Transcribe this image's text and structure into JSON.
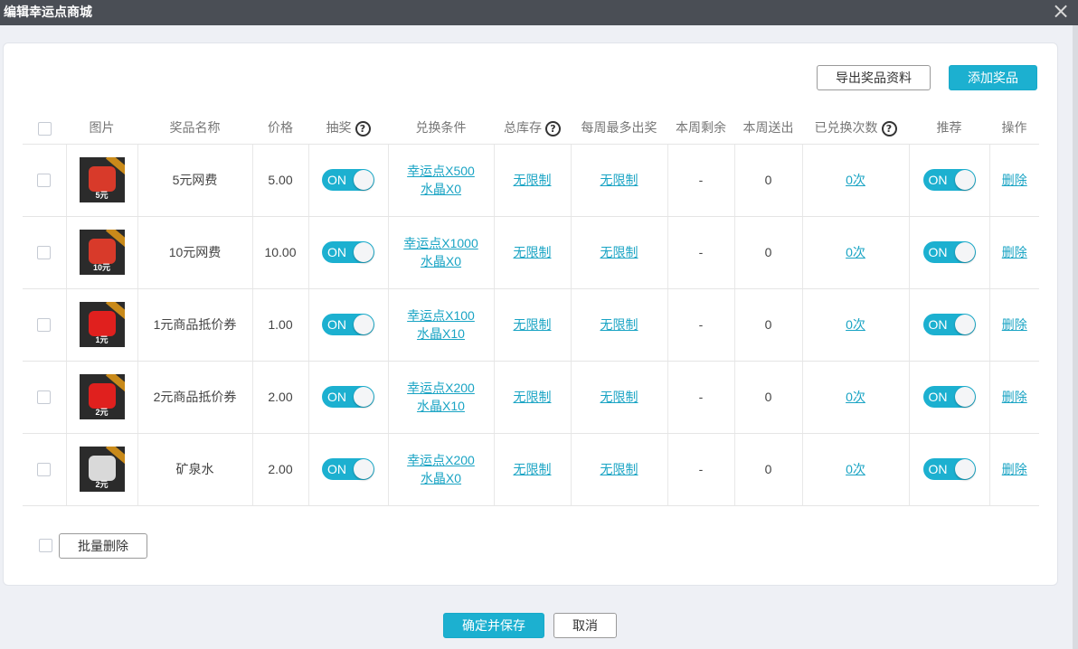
{
  "window": {
    "title": "编辑幸运点商城",
    "close_glyph": "×"
  },
  "toolbar": {
    "export_label": "导出奖品资料",
    "add_label": "添加奖品"
  },
  "table": {
    "headers": [
      "图片",
      "奖品名称",
      "价格",
      "抽奖",
      "兑换条件",
      "总库存",
      "每周最多出奖",
      "本周剩余",
      "本周送出",
      "已兑换次数",
      "推荐",
      "操作"
    ],
    "help_glyph": "?",
    "toggle_on": "ON",
    "rows": [
      {
        "image_label": "5元",
        "image_color": "#d83a2a",
        "name": "5元网费",
        "price": "5.00",
        "cond1": "幸运点X500",
        "cond2": "水晶X0",
        "stock": "无限制",
        "weekly_max": "无限制",
        "week_left": "-",
        "week_sent": "0",
        "redeemed": "0次",
        "delete": "删除"
      },
      {
        "image_label": "10元",
        "image_color": "#d83a2a",
        "name": "10元网费",
        "price": "10.00",
        "cond1": "幸运点X1000",
        "cond2": "水晶X0",
        "stock": "无限制",
        "weekly_max": "无限制",
        "week_left": "-",
        "week_sent": "0",
        "redeemed": "0次",
        "delete": "删除"
      },
      {
        "image_label": "1元",
        "image_color": "#e0201e",
        "name": "1元商品抵价券",
        "price": "1.00",
        "cond1": "幸运点X100",
        "cond2": "水晶X10",
        "stock": "无限制",
        "weekly_max": "无限制",
        "week_left": "-",
        "week_sent": "0",
        "redeemed": "0次",
        "delete": "删除"
      },
      {
        "image_label": "2元",
        "image_color": "#e0201e",
        "name": "2元商品抵价券",
        "price": "2.00",
        "cond1": "幸运点X200",
        "cond2": "水晶X10",
        "stock": "无限制",
        "weekly_max": "无限制",
        "week_left": "-",
        "week_sent": "0",
        "redeemed": "0次",
        "delete": "删除"
      },
      {
        "image_label": "2元",
        "image_color": "#d9d9d9",
        "name": "矿泉水",
        "price": "2.00",
        "cond1": "幸运点X200",
        "cond2": "水晶X0",
        "stock": "无限制",
        "weekly_max": "无限制",
        "week_left": "-",
        "week_sent": "0",
        "redeemed": "0次",
        "delete": "删除"
      }
    ]
  },
  "footer": {
    "batch_delete_label": "批量删除",
    "confirm_label": "确定并保存",
    "cancel_label": "取消"
  },
  "colors": {
    "accent": "#1cb0d0",
    "titlebar": "#4a4e55"
  }
}
